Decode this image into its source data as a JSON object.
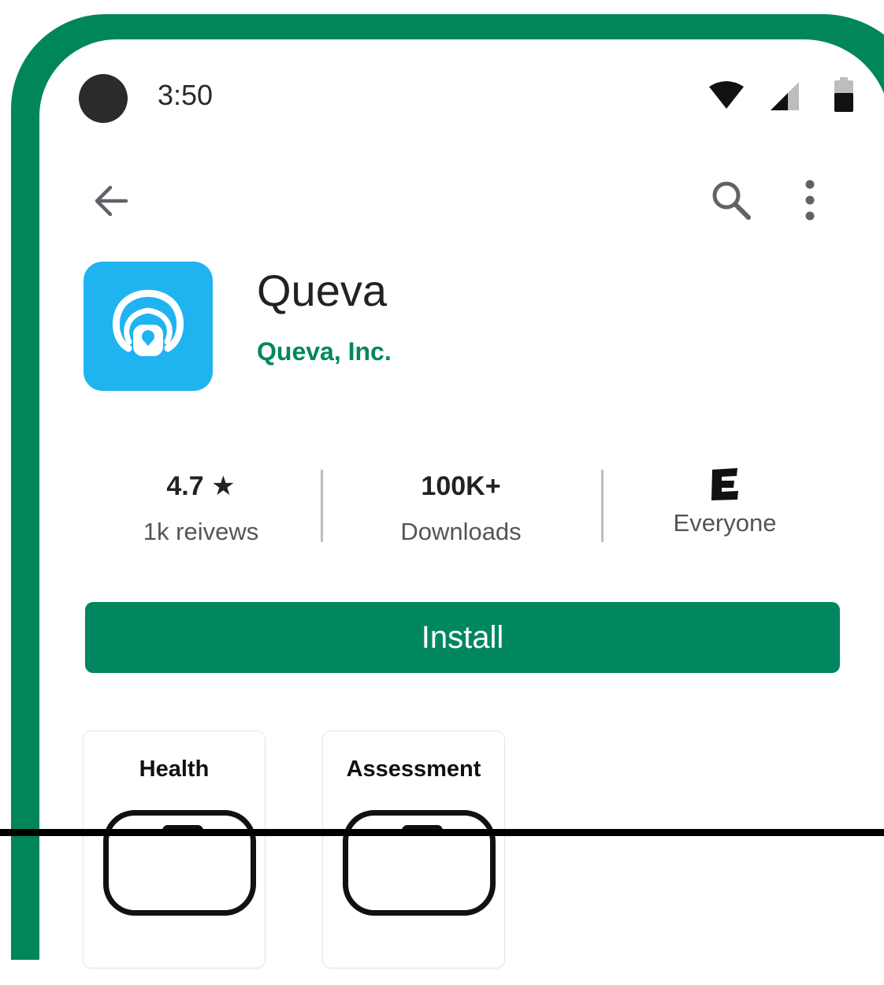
{
  "status_bar": {
    "time": "3:50"
  },
  "app": {
    "name": "Queva",
    "developer": "Queva, Inc."
  },
  "stats": {
    "rating": {
      "value": "4.7",
      "label": "1k reivews"
    },
    "downloads": {
      "value": "100K+",
      "label": "Downloads"
    },
    "content_rating": {
      "value": "E",
      "label": "Everyone"
    }
  },
  "install": {
    "label": "Install"
  },
  "screenshots": [
    {
      "caption": "Health"
    },
    {
      "caption": "Assessment"
    }
  ],
  "colors": {
    "accent": "#01875f",
    "app_icon_bg": "#1fb3f0",
    "bezel": "#00865a"
  },
  "icons": [
    "back-arrow-icon",
    "search-icon",
    "more-vert-icon",
    "wifi-icon",
    "signal-icon",
    "battery-icon",
    "star-icon",
    "esrb-e-icon"
  ]
}
